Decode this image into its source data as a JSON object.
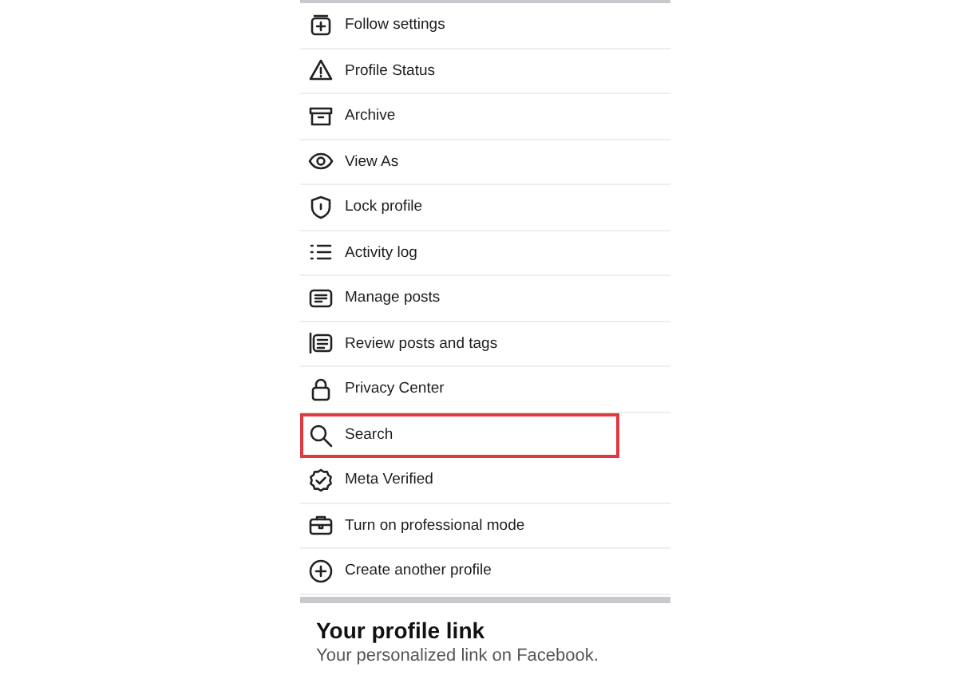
{
  "menu_items": [
    {
      "label": "Follow settings",
      "highlighted": false
    },
    {
      "label": "Profile Status",
      "highlighted": false
    },
    {
      "label": "Archive",
      "highlighted": false
    },
    {
      "label": "View As",
      "highlighted": false
    },
    {
      "label": "Lock profile",
      "highlighted": false
    },
    {
      "label": "Activity log",
      "highlighted": false
    },
    {
      "label": "Manage posts",
      "highlighted": false
    },
    {
      "label": "Review posts and tags",
      "highlighted": false
    },
    {
      "label": "Privacy Center",
      "highlighted": false
    },
    {
      "label": "Search",
      "highlighted": true
    },
    {
      "label": "Meta Verified",
      "highlighted": false
    },
    {
      "label": "Turn on professional mode",
      "highlighted": false
    },
    {
      "label": "Create another profile",
      "highlighted": false
    }
  ],
  "profile_link": {
    "title": "Your profile link",
    "subtitle": "Your personalized link on Facebook."
  }
}
